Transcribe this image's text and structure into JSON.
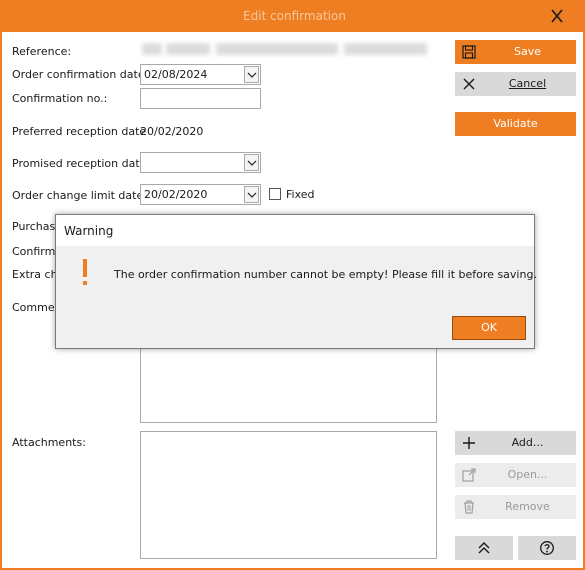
{
  "window": {
    "title": "Edit confirmation"
  },
  "form": {
    "reference_label": "Reference:",
    "order_confirmation_date_label": "Order confirmation date:",
    "order_confirmation_date_value": "02/08/2024",
    "confirmation_no_label": "Confirmation no.:",
    "confirmation_no_value": "",
    "preferred_reception_label": "Preferred reception date",
    "preferred_reception_value": "20/02/2020",
    "promised_reception_label": "Promised reception date",
    "promised_reception_value": "",
    "order_change_limit_label": "Order change limit date:",
    "order_change_limit_value": "20/02/2020",
    "fixed_label": "Fixed",
    "fixed_checked": false,
    "purchase_label_partial": "Purchas",
    "confirmed_label_partial": "Confirm",
    "extra_label_partial": "Extra ch",
    "comment_label_partial": "Commer",
    "attachments_label": "Attachments:"
  },
  "actions": {
    "save": "Save",
    "cancel": "Cancel",
    "validate": "Validate confirmation...",
    "add": "Add...",
    "open": "Open...",
    "remove": "Remove"
  },
  "dialog": {
    "title": "Warning",
    "message": "The order confirmation number cannot be empty! Please fill it before saving.",
    "ok": "OK"
  },
  "colors": {
    "accent": "#ef7d22",
    "neutral_button": "#d9d9d9"
  },
  "icons": {
    "close": "close-icon",
    "save": "save-icon",
    "cancel": "cancel-x-icon",
    "add": "plus-icon",
    "open": "open-external-icon",
    "remove": "trash-icon",
    "collapse": "double-chevron-up-icon",
    "help": "help-icon",
    "warning": "warning-exclamation-icon",
    "dropdown": "chevron-down-icon"
  }
}
